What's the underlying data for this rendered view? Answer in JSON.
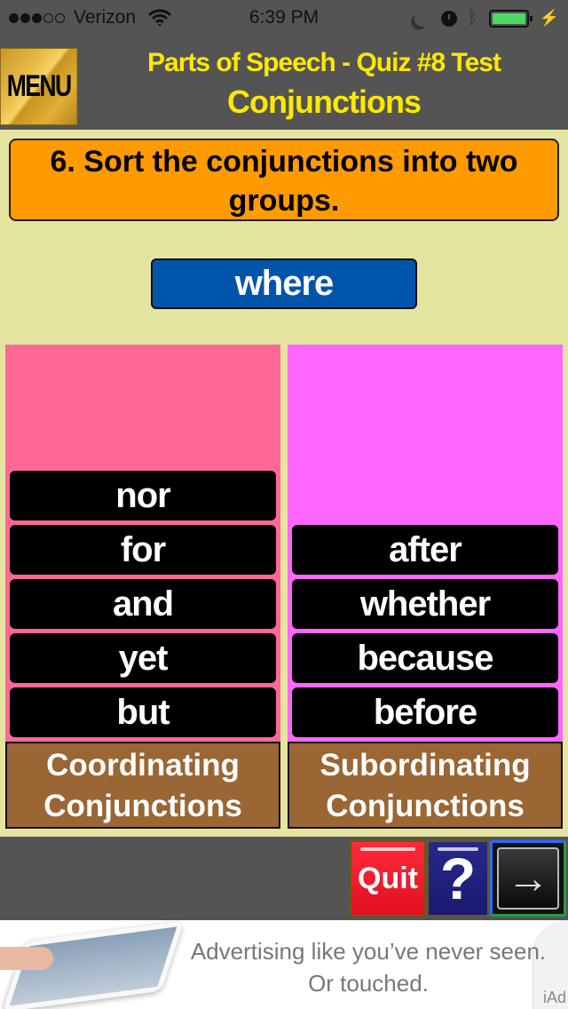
{
  "status_bar": {
    "signal_bars_filled": 3,
    "signal_bars_total": 5,
    "carrier": "Verizon",
    "time": "6:39 PM",
    "icons": [
      "wifi-icon",
      "moon-icon",
      "alarm-icon",
      "bluetooth-icon",
      "battery-icon",
      "charging-icon"
    ],
    "battery_level": 1.0,
    "battery_color": "#4cd964"
  },
  "header": {
    "menu_label": "MENU",
    "title": "Parts of Speech - Quiz #8 Test",
    "subtitle": "Conjunctions",
    "title_color": "#ffe800"
  },
  "question": {
    "text": "6. Sort the conjunctions into two groups."
  },
  "current_word": "where",
  "columns": [
    {
      "label": "Coordinating Conjunctions",
      "color": "#ff6896",
      "words": [
        "nor",
        "for",
        "and",
        "yet",
        "but"
      ]
    },
    {
      "label": "Subordinating Conjunctions",
      "color": "#ff66ff",
      "words": [
        "after",
        "whether",
        "because",
        "before"
      ]
    }
  ],
  "toolbar": {
    "quit_label": "Quit",
    "help_label": "?",
    "next_label": "→"
  },
  "ad": {
    "line1": "Advertising like you’ve never seen.",
    "line2": "Or touched.",
    "brand": "iAd"
  }
}
